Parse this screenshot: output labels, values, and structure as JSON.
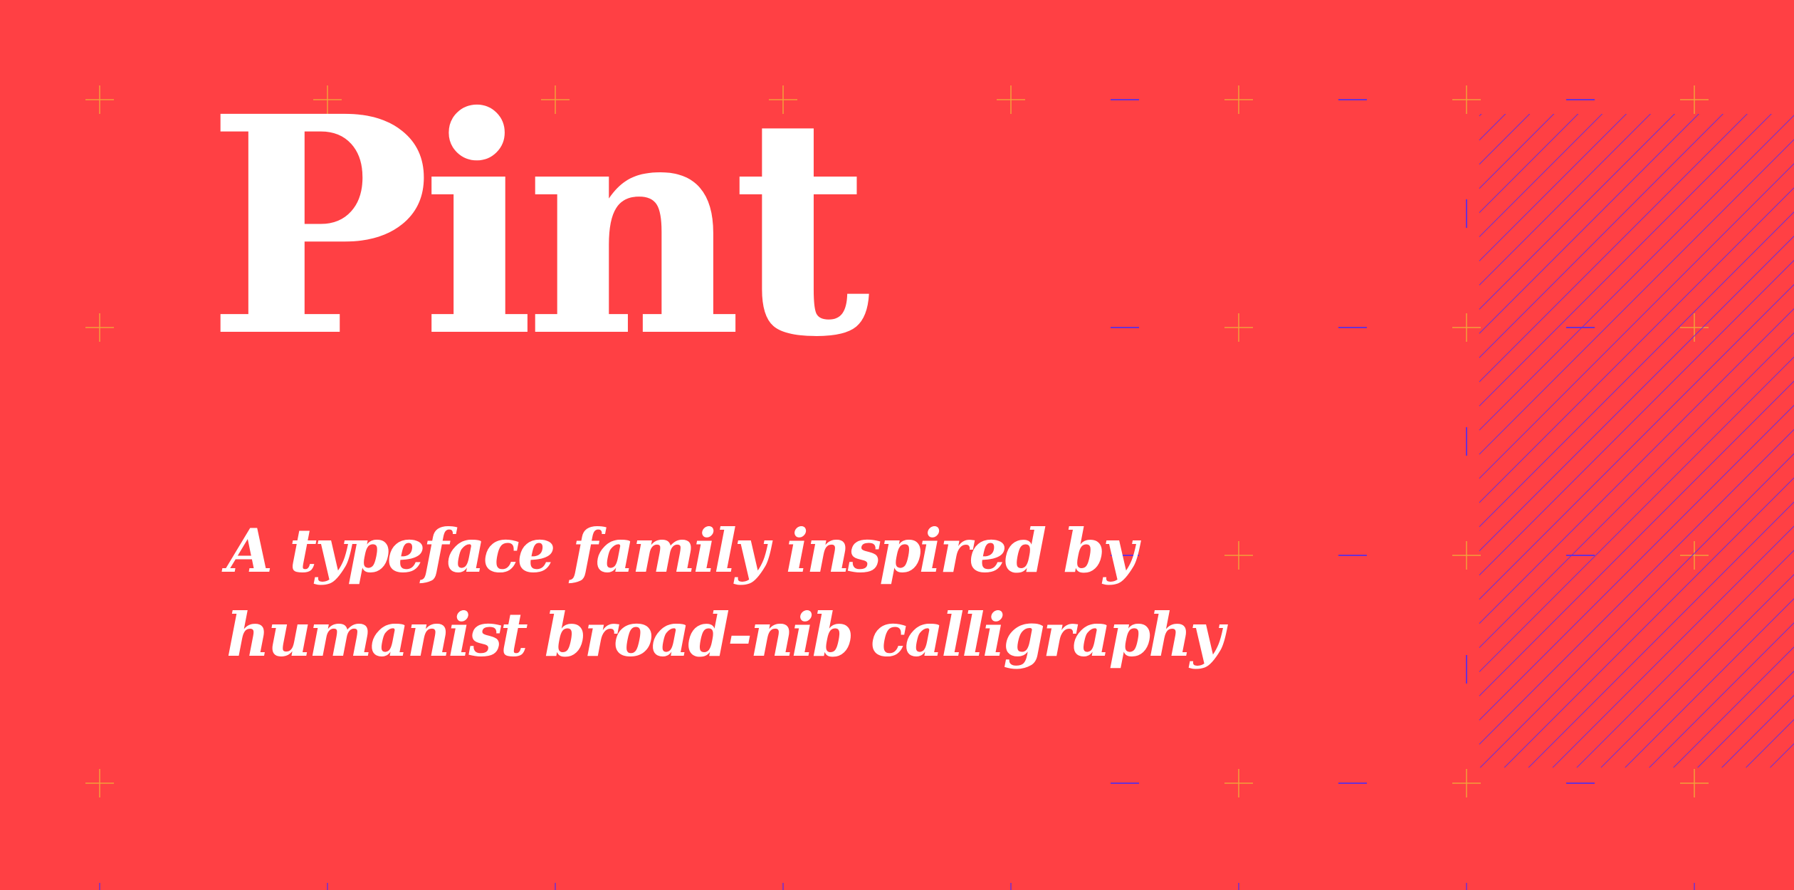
{
  "brand": {
    "title": "Pint",
    "tagline_line1": "A typeface family inspired by",
    "tagline_line2": "humanist broad-nib calligraphy"
  },
  "colors": {
    "background": "#ff4044",
    "text": "#ffffff",
    "grid_mark_orange": "#f2a03a",
    "guide_purple": "#6a2fd6"
  },
  "decorations": {
    "grid_marks_icon": "plus-crosshair",
    "hatch_pattern_icon": "diagonal-lines"
  }
}
